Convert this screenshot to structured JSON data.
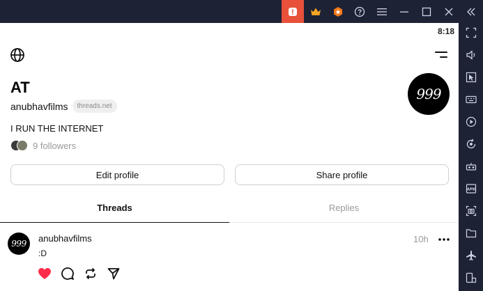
{
  "status_bar": {
    "time": "8:18"
  },
  "profile": {
    "display_name": "AT",
    "username": "anubhavfilms",
    "domain_badge": "threads.net",
    "bio": "I RUN THE INTERNET",
    "followers": "9 followers",
    "avatar_text": "999"
  },
  "actions": {
    "edit_profile": "Edit profile",
    "share_profile": "Share profile"
  },
  "tabs": [
    {
      "label": "Threads",
      "active": true
    },
    {
      "label": "Replies",
      "active": false
    }
  ],
  "post": {
    "username": "anubhavfilms",
    "time": "10h",
    "text": ":D",
    "avatar_text": "999",
    "liked": true
  },
  "colors": {
    "emulator_bg": "#1e2235",
    "alert_red": "#e8503a",
    "crown_gold": "#f5a623",
    "badge_orange": "#f27a1a",
    "like_red": "#ff2d4a"
  },
  "icons": {
    "titlebar": [
      "alert-icon",
      "crown-icon",
      "star-badge-icon",
      "help-icon",
      "menu-icon",
      "minimize-icon",
      "maximize-icon",
      "close-icon",
      "collapse-icon"
    ],
    "sidebar": [
      "fullscreen-icon",
      "volume-icon",
      "pointer-icon",
      "keyboard-icon",
      "play-icon",
      "rotate-icon",
      "controller-icon",
      "apk-icon",
      "screenshot-icon",
      "folder-icon",
      "airplane-icon",
      "multi-instance-icon"
    ]
  }
}
